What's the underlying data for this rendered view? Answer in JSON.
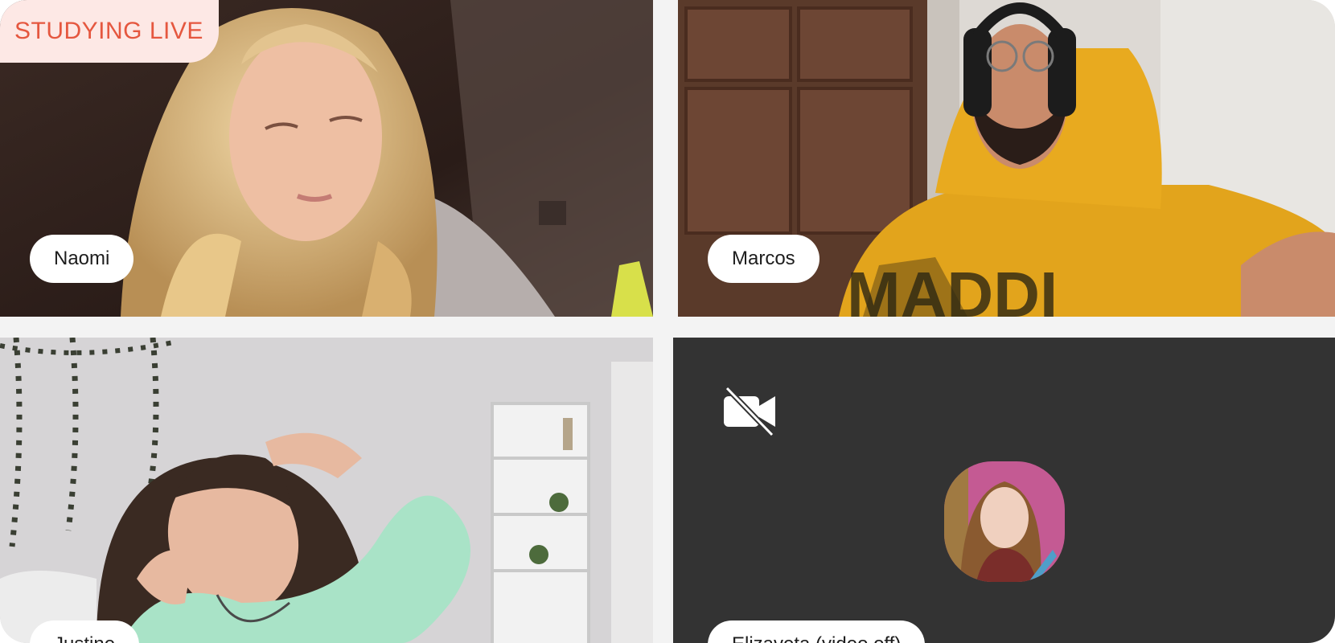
{
  "badge": {
    "label": "STUDYING LIVE"
  },
  "participants": [
    {
      "name": "Naomi",
      "video": "on"
    },
    {
      "name": "Marcos",
      "video": "on"
    },
    {
      "name": "Justine",
      "video": "on"
    },
    {
      "name": "Elizaveta (video off)",
      "video": "off"
    }
  ],
  "icons": {
    "video_off": "video-off-icon"
  },
  "colors": {
    "badge_bg": "#fde8e5",
    "badge_text": "#e5573f",
    "video_off_tile": "#333333",
    "pill_bg": "#ffffff"
  }
}
